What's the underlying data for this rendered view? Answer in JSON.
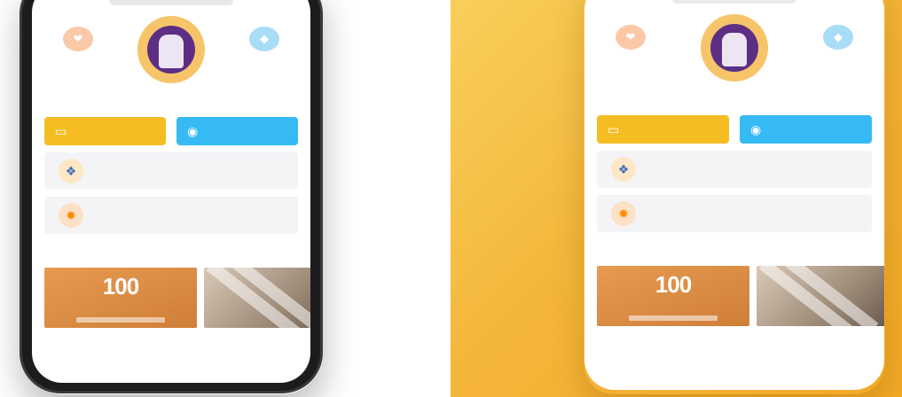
{
  "scene": {
    "background_right": "#f4b63a",
    "accent_yellow": "#f6bd23",
    "accent_blue": "#36baf4"
  },
  "screen": {
    "left_icon": {
      "name": "heart-icon",
      "glyph": "❤",
      "label": ""
    },
    "right_icon": {
      "name": "diamond-icon",
      "glyph": "◆",
      "label": ""
    },
    "avatar_icon": "avatar-icon",
    "user": {
      "name": "",
      "subtitle": ""
    },
    "actions": [
      {
        "icon": "message-icon",
        "glyph": "▭",
        "title": "",
        "value": ""
      },
      {
        "icon": "coin-icon",
        "glyph": "◉",
        "title": "",
        "value": ""
      }
    ],
    "info_cards": [
      {
        "icon": "box-icon",
        "glyph": "❖",
        "title": "",
        "desc": ""
      },
      {
        "icon": "gift-icon",
        "glyph": "✹",
        "title": "",
        "desc": ""
      }
    ],
    "section": {
      "title": "",
      "link": ""
    },
    "promos": [
      {
        "big_number": "100",
        "sub": "",
        "caption": ""
      },
      {
        "big_number": "",
        "sub": "",
        "caption": ""
      }
    ]
  }
}
